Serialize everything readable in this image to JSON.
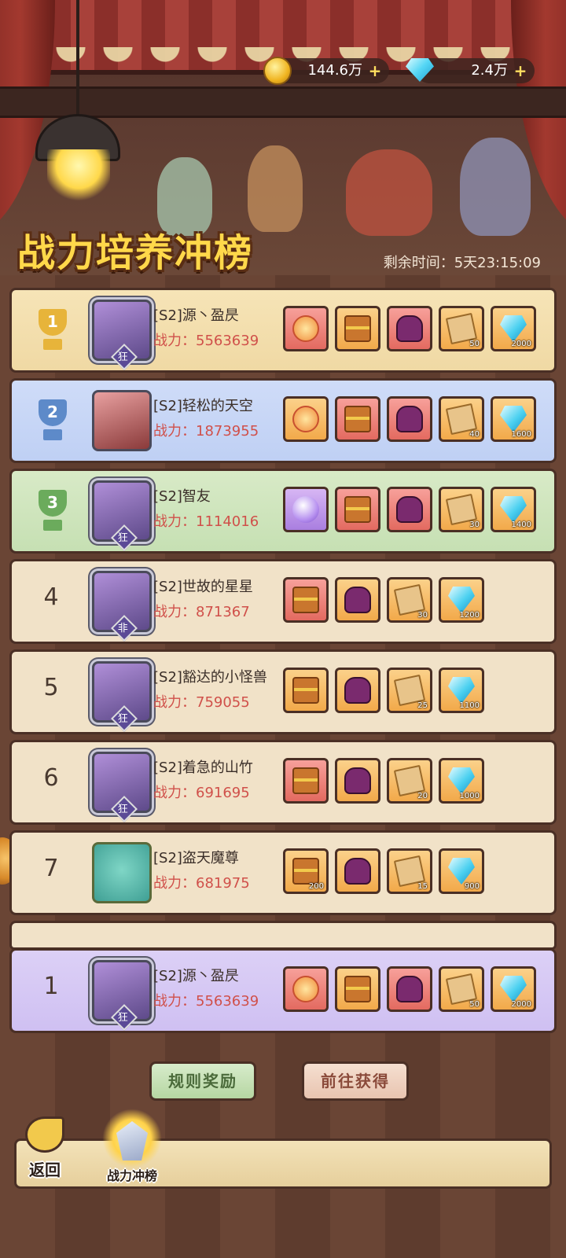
{
  "currency": {
    "gold": {
      "value": "144.6万",
      "plus": "+",
      "icon": "gold-coin-icon"
    },
    "gems": {
      "value": "2.4万",
      "plus": "+",
      "icon": "diamond-icon"
    }
  },
  "header": {
    "title": "战力培养冲榜",
    "timer_label": "剩余时间：",
    "timer_value": "5天23:15:09"
  },
  "power_label": "战力：",
  "rankings": [
    {
      "rank": "1",
      "name": "[S2]源丶盈昃",
      "power": "5563639",
      "badge": "狂",
      "rewards": [
        {
          "icon": "wing-badge-icon",
          "bg": "red",
          "qty": ""
        },
        {
          "icon": "gold-chest-icon",
          "bg": "orange",
          "qty": ""
        },
        {
          "icon": "monster-chest-icon",
          "bg": "red",
          "qty": ""
        },
        {
          "icon": "scroll-icon",
          "bg": "orange",
          "qty": "50"
        },
        {
          "icon": "diamond-icon",
          "bg": "orange",
          "qty": "2000"
        }
      ]
    },
    {
      "rank": "2",
      "name": "[S2]轻松的天空",
      "power": "1873955",
      "badge": "",
      "rewards": [
        {
          "icon": "wing-badge-icon",
          "bg": "orange",
          "qty": ""
        },
        {
          "icon": "red-chest-icon",
          "bg": "red",
          "qty": ""
        },
        {
          "icon": "monster-chest-icon",
          "bg": "red",
          "qty": ""
        },
        {
          "icon": "scroll-icon",
          "bg": "orange",
          "qty": "40"
        },
        {
          "icon": "diamond-icon",
          "bg": "orange",
          "qty": "1600"
        }
      ]
    },
    {
      "rank": "3",
      "name": "[S2]智友",
      "power": "1114016",
      "badge": "狂",
      "rewards": [
        {
          "icon": "purple-orb-badge-icon",
          "bg": "purple",
          "qty": ""
        },
        {
          "icon": "red-chest-icon",
          "bg": "red",
          "qty": ""
        },
        {
          "icon": "monster-chest-icon",
          "bg": "red",
          "qty": ""
        },
        {
          "icon": "scroll-icon",
          "bg": "orange",
          "qty": "30"
        },
        {
          "icon": "diamond-icon",
          "bg": "orange",
          "qty": "1400"
        }
      ]
    },
    {
      "rank": "4",
      "name": "[S2]世故的星星",
      "power": "871367",
      "badge": "非",
      "rewards": [
        {
          "icon": "red-chest-icon",
          "bg": "red",
          "qty": ""
        },
        {
          "icon": "monster-chest-icon",
          "bg": "orange",
          "qty": ""
        },
        {
          "icon": "scroll-icon",
          "bg": "orange",
          "qty": "30"
        },
        {
          "icon": "diamond-icon",
          "bg": "orange",
          "qty": "1200"
        }
      ]
    },
    {
      "rank": "5",
      "name": "[S2]豁达的小怪兽",
      "power": "759055",
      "badge": "狂",
      "rewards": [
        {
          "icon": "red-chest-icon",
          "bg": "orange",
          "qty": ""
        },
        {
          "icon": "monster-chest-icon",
          "bg": "orange",
          "qty": ""
        },
        {
          "icon": "scroll-icon",
          "bg": "orange",
          "qty": "25"
        },
        {
          "icon": "diamond-icon",
          "bg": "orange",
          "qty": "1100"
        }
      ]
    },
    {
      "rank": "6",
      "name": "[S2]着急的山竹",
      "power": "691695",
      "badge": "狂",
      "rewards": [
        {
          "icon": "red-chest-icon",
          "bg": "red",
          "qty": ""
        },
        {
          "icon": "monster-chest-icon",
          "bg": "orange",
          "qty": ""
        },
        {
          "icon": "scroll-icon",
          "bg": "orange",
          "qty": "20"
        },
        {
          "icon": "diamond-icon",
          "bg": "orange",
          "qty": "1000"
        }
      ]
    },
    {
      "rank": "7",
      "name": "[S2]盗天魔尊",
      "power": "681975",
      "badge": "",
      "rewards": [
        {
          "icon": "wooden-chest-icon",
          "bg": "orange",
          "qty": "200"
        },
        {
          "icon": "monster-chest-icon",
          "bg": "orange",
          "qty": ""
        },
        {
          "icon": "scroll-icon",
          "bg": "orange",
          "qty": "15"
        },
        {
          "icon": "diamond-icon",
          "bg": "orange",
          "qty": "900"
        }
      ]
    }
  ],
  "my_rank": {
    "rank": "1",
    "name": "[S2]源丶盈昃",
    "power": "5563639",
    "badge": "狂",
    "rewards": [
      {
        "icon": "wing-badge-icon",
        "bg": "red",
        "qty": ""
      },
      {
        "icon": "gold-chest-icon",
        "bg": "orange",
        "qty": ""
      },
      {
        "icon": "monster-chest-icon",
        "bg": "red",
        "qty": ""
      },
      {
        "icon": "scroll-icon",
        "bg": "orange",
        "qty": "50"
      },
      {
        "icon": "diamond-icon",
        "bg": "orange",
        "qty": "2000"
      }
    ]
  },
  "buttons": {
    "rules": "规则奖励",
    "goto": "前往获得"
  },
  "bottom_nav": {
    "back": "返回",
    "power_tab": "战力冲榜"
  }
}
